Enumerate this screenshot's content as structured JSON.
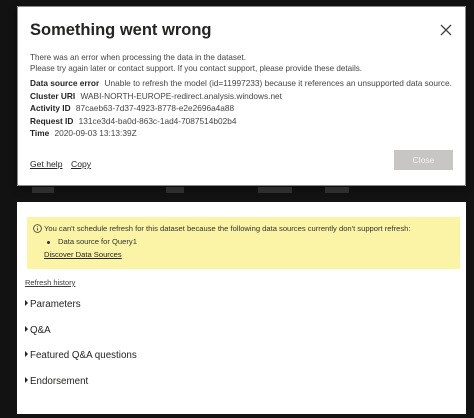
{
  "dialog": {
    "title": "Something went wrong",
    "message_line1": "There was an error when processing the data in the dataset.",
    "message_line2": "Please try again later or contact support. If you contact support, please provide these details.",
    "details": [
      {
        "label": "Data source error",
        "value": "Unable to refresh the model (id=11997233) because it references an unsupported data source."
      },
      {
        "label": "Cluster URI",
        "value": "WABI-NORTH-EUROPE-redirect.analysis.windows.net"
      },
      {
        "label": "Activity ID",
        "value": "87caeb63-7d37-4923-8778-e2e2696a4a88"
      },
      {
        "label": "Request ID",
        "value": "131ce3d4-ba0d-863c-1ad4-7087514b02b4"
      },
      {
        "label": "Time",
        "value": "2020-09-03 13:13:39Z"
      }
    ],
    "get_help": "Get help",
    "copy": "Copy",
    "close_button": "Close"
  },
  "warning": {
    "text": "You can't schedule refresh for this dataset because the following data sources currently don't support refresh:",
    "bullet": "Data source for Query1",
    "link": "Discover Data Sources"
  },
  "refresh_history": "Refresh history",
  "sections": [
    "Parameters",
    "Q&A",
    "Featured Q&A questions",
    "Endorsement"
  ],
  "colors": {
    "warning_bg": "#fbf4a6",
    "button_disabled": "#c8c6c4",
    "page_bg": "#121212"
  }
}
